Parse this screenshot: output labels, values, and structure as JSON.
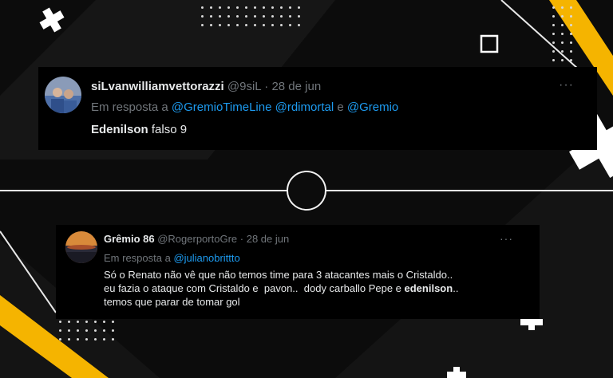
{
  "colors": {
    "background": "#0c0c0c",
    "card": "#000000",
    "accent_yellow": "#f5b400",
    "mention": "#1d9bf0",
    "muted": "#71767b",
    "text": "#e7e9ea"
  },
  "tweet1": {
    "display_name": "siLvanwilliamvettorazzi",
    "handle": "@9siL",
    "separator": "·",
    "date": "28 de jun",
    "reply_prefix": "Em resposta a",
    "mentions": [
      "@GremioTimeLine",
      "@rdimortal"
    ],
    "reply_joiner": "e",
    "mention_last": "@Gremio",
    "text_bold": "Edenilson",
    "text_rest": " falso 9",
    "more_icon": "more-options-icon"
  },
  "tweet2": {
    "display_name": "Grêmio 86",
    "handle": "@RogerportoGre",
    "separator": "·",
    "date": "28 de jun",
    "reply_prefix": "Em resposta a",
    "mention": "@julianobrittto",
    "line1": "Só o Renato não vê que não temos time para 3 atacantes mais o Cristaldo..",
    "line2_pre": "eu fazia o ataque com Cristaldo e  pavon..  dody carballo Pepe e ",
    "line2_bold": "edenilson",
    "line2_post": "..",
    "line3": "temos que parar de tomar gol",
    "more_icon": "more-options-icon"
  }
}
